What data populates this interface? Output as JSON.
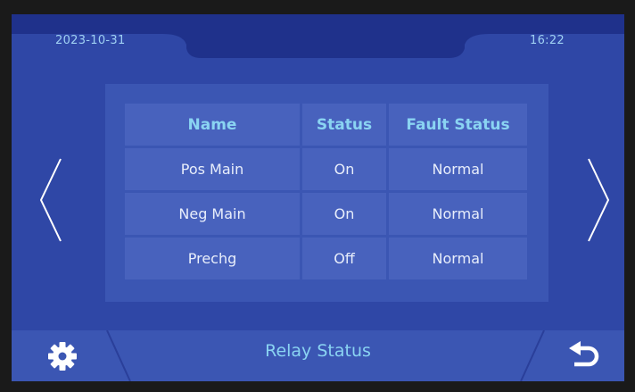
{
  "header": {
    "date": "2023-10-31",
    "time": "16:22"
  },
  "relay_table": {
    "headers": [
      "Name",
      "Status",
      "Fault Status"
    ],
    "rows": [
      {
        "name": "Pos Main",
        "status": "On",
        "fault_status": "Normal"
      },
      {
        "name": "Neg Main",
        "status": "On",
        "fault_status": "Normal"
      },
      {
        "name": "Prechg",
        "status": "Off",
        "fault_status": "Normal"
      }
    ]
  },
  "footer": {
    "title": "Relay Status"
  },
  "icons": {
    "left": "settings-gear-icon",
    "right": "back-arrow-icon",
    "prev": "chevron-left-icon",
    "next": "chevron-right-icon"
  },
  "colors": {
    "background": "#2f47a6",
    "panel": "#3b56b3",
    "cell": "#4862bd",
    "header_text": "#8ad4f2",
    "body_text": "#e8eefb"
  }
}
